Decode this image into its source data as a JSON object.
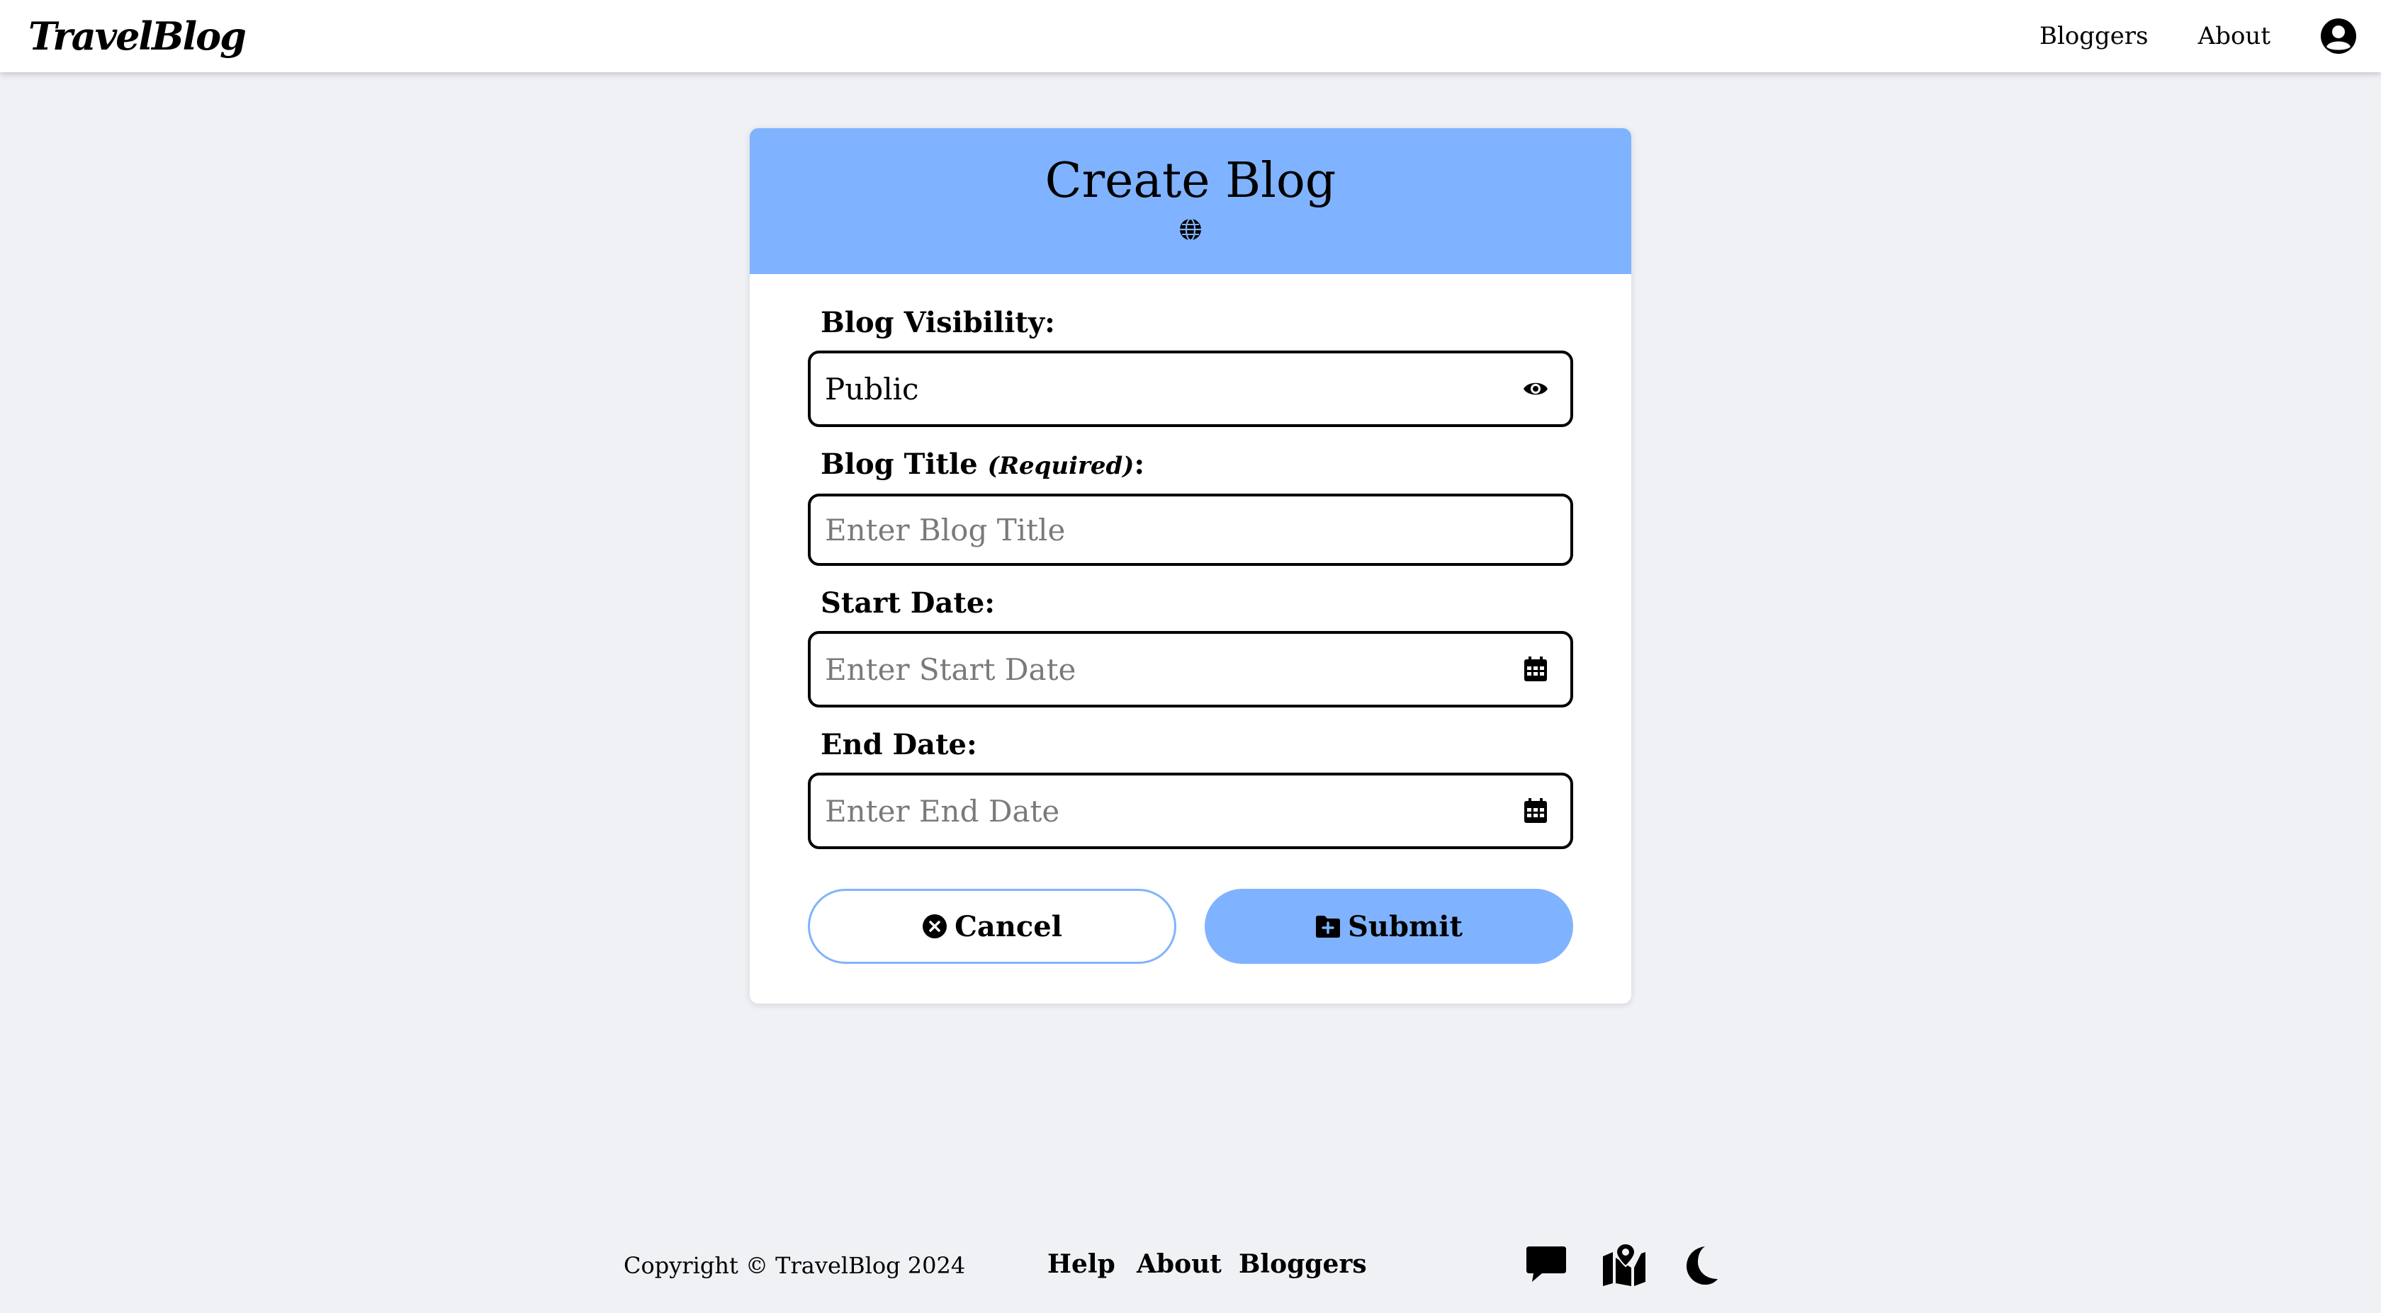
{
  "header": {
    "brand": "TravelBlog",
    "nav": [
      "Bloggers",
      "About"
    ]
  },
  "card": {
    "title": "Create Blog",
    "visibility_label": "Blog Visibility:",
    "visibility_value": "Public",
    "title_label": "Blog Title",
    "title_required": "(Required)",
    "title_colon": ":",
    "title_placeholder": "Enter Blog Title",
    "start_label": "Start Date:",
    "start_placeholder": "Enter Start Date",
    "end_label": "End Date:",
    "end_placeholder": "Enter End Date",
    "cancel_label": "Cancel",
    "submit_label": "Submit"
  },
  "footer": {
    "copyright": "Copyright © TravelBlog 2024",
    "links": [
      "Help",
      "About",
      "Bloggers"
    ]
  },
  "colors": {
    "accent": "#80b3ff",
    "background": "#f0f1f5"
  }
}
